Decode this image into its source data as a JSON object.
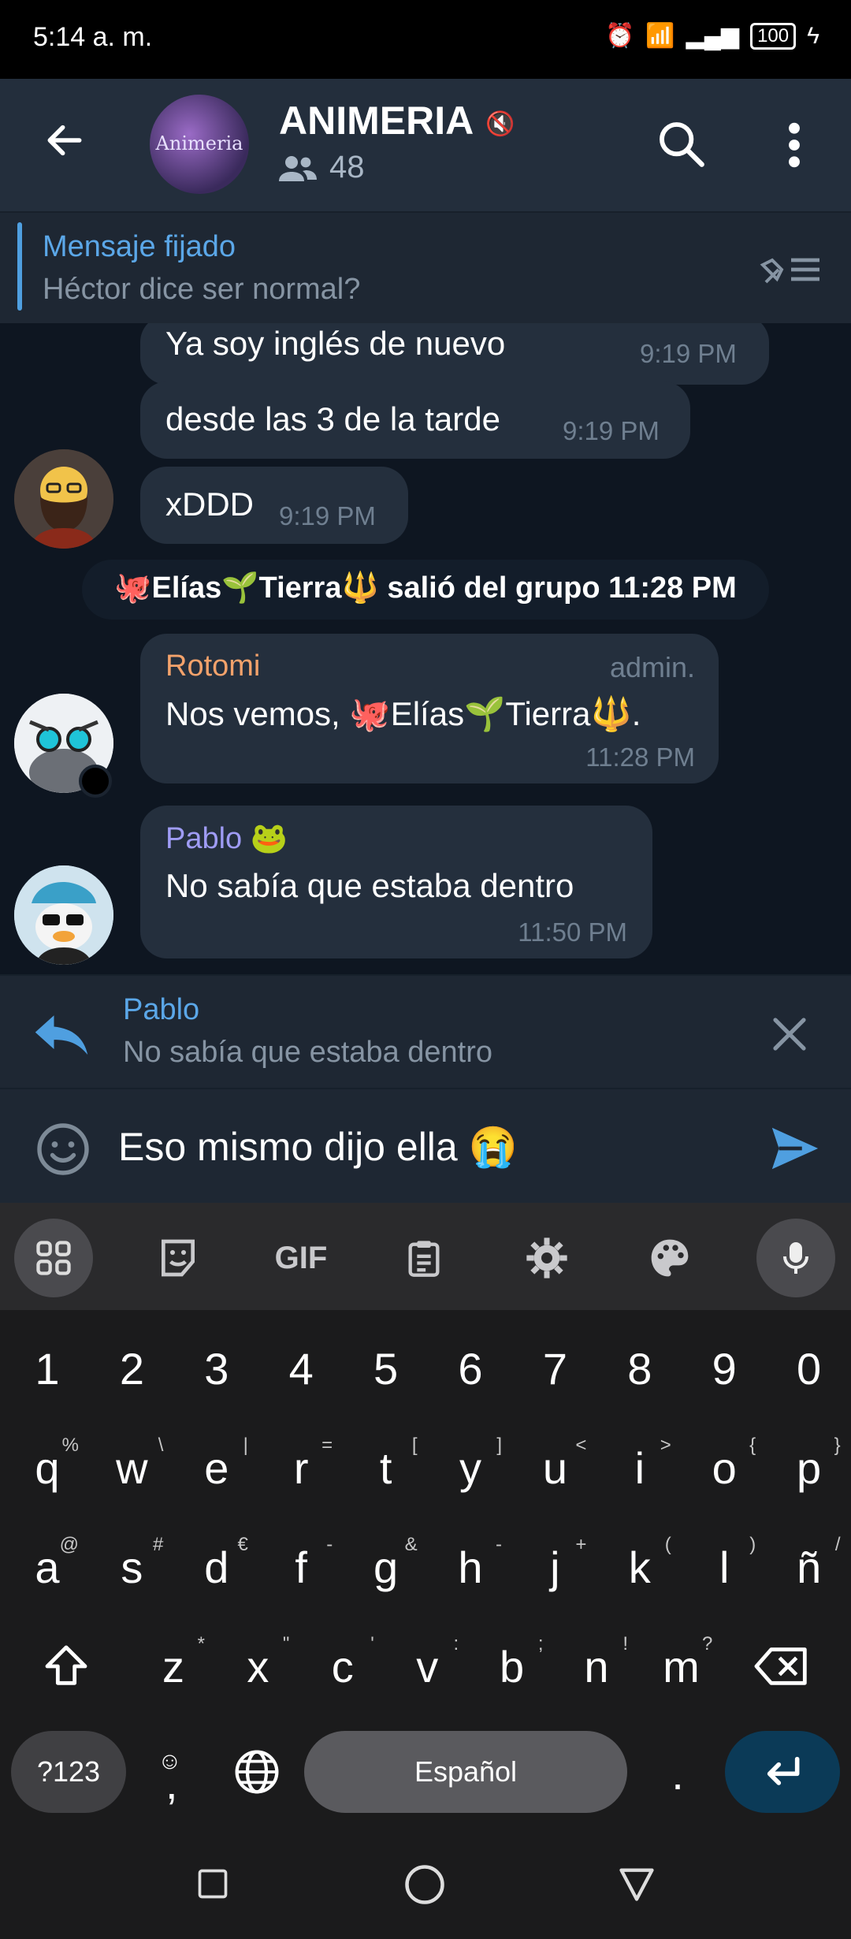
{
  "status_bar": {
    "time": "5:14 a. m.",
    "battery": "100"
  },
  "header": {
    "title": "ANIMERIA",
    "members": "48",
    "avatar_text": "Animeria"
  },
  "pinned": {
    "title": "Mensaje fijado",
    "text": "Héctor dice ser normal?"
  },
  "messages": [
    {
      "text": "Ya soy inglés de nuevo",
      "time": "9:19 PM"
    },
    {
      "text": "desde las 3 de la tarde",
      "time": "9:19 PM"
    },
    {
      "text": "xDDD",
      "time": "9:19 PM"
    },
    {
      "service": true,
      "text": "🐙Elías🌱Tierra🔱 salió del grupo  11:28 PM"
    },
    {
      "sender": "Rotomi",
      "badge": "admin.",
      "text": "Nos vemos, 🐙Elías🌱Tierra🔱.",
      "time": "11:28 PM"
    },
    {
      "sender": "Pablo 🐸",
      "text": "No sabía que estaba dentro",
      "time": "11:50 PM"
    }
  ],
  "reply": {
    "name": "Pablo",
    "text": "No sabía que estaba dentro"
  },
  "composer": {
    "value": "Eso mismo dijo ella 😭"
  },
  "keyboard": {
    "toolbar": [
      "apps",
      "sticker",
      "GIF",
      "clipboard",
      "settings",
      "palette",
      "mic"
    ],
    "gif_label": "GIF",
    "numbers": [
      "1",
      "2",
      "3",
      "4",
      "5",
      "6",
      "7",
      "8",
      "9",
      "0"
    ],
    "row1": [
      [
        "q",
        "%"
      ],
      [
        "w",
        "\\"
      ],
      [
        "e",
        "|"
      ],
      [
        "r",
        "="
      ],
      [
        "t",
        "["
      ],
      [
        "y",
        "]"
      ],
      [
        "u",
        "<"
      ],
      [
        "i",
        ">"
      ],
      [
        "o",
        "{"
      ],
      [
        "p",
        "}"
      ]
    ],
    "row2": [
      [
        "a",
        "@"
      ],
      [
        "s",
        "#"
      ],
      [
        "d",
        "€"
      ],
      [
        "f",
        "-"
      ],
      [
        "g",
        "&"
      ],
      [
        "h",
        "-"
      ],
      [
        "j",
        "+"
      ],
      [
        "k",
        "("
      ],
      [
        "l",
        ")"
      ],
      [
        "ñ",
        "/"
      ]
    ],
    "row3": [
      [
        "z",
        "*"
      ],
      [
        "x",
        "\""
      ],
      [
        "c",
        "'"
      ],
      [
        "v",
        ":"
      ],
      [
        "b",
        ";"
      ],
      [
        "n",
        "!"
      ],
      [
        "m",
        "?"
      ]
    ],
    "symbols_label": "?123",
    "comma": ",",
    "space_label": "Español",
    "period": "."
  },
  "colors": {
    "header": "#232e3c",
    "chat_bg": "#0e1621",
    "bubble": "#242f3d",
    "accent": "#5ba7e8",
    "rotomi": "#f3a26b",
    "pablo": "#9f9cf5",
    "enter_key": "#0b3a57"
  }
}
